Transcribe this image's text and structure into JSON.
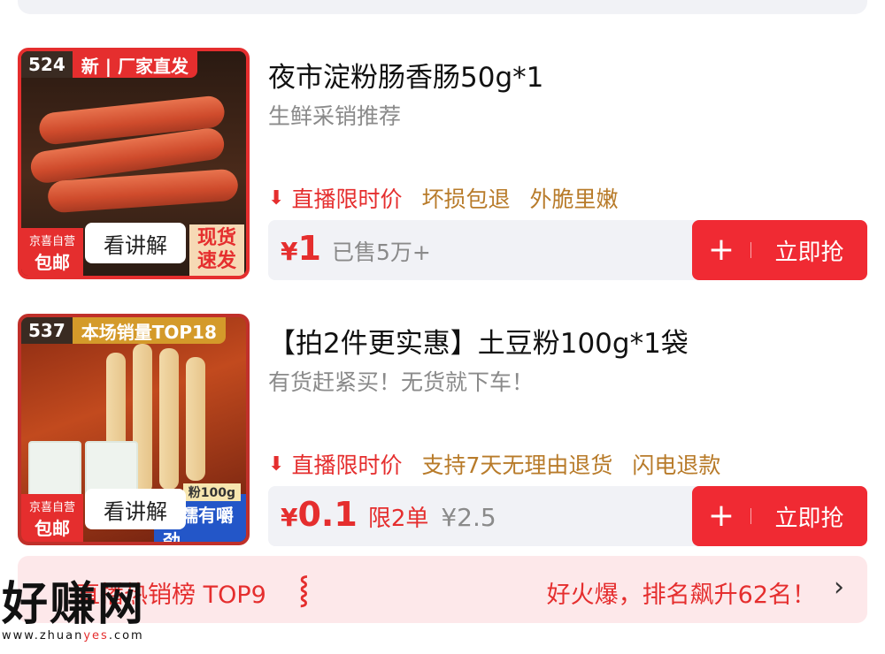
{
  "products": [
    {
      "rank": "524",
      "rank_tag": "新 | 厂家直发",
      "title": "夜市淀粉肠香肠50g*1",
      "subtitle": "生鲜采销推荐",
      "tags": [
        "直播限时价",
        "坏损包退",
        "外脆里嫩"
      ],
      "badge_top": "京喜自营",
      "badge_bottom": "包邮",
      "explain": "看讲解",
      "promo": "现货速发",
      "price_symbol": "¥",
      "price": "1",
      "sold": "已售5万+",
      "grab_label": "立即抢"
    },
    {
      "rank": "537",
      "rank_tag": "本场销量TOP18",
      "title": "【拍2件更实惠】土豆粉100g*1袋",
      "subtitle": "有货赶紧买！无货就下车！",
      "tags": [
        "直播限时价",
        "支持7天无理由退货",
        "闪电退款"
      ],
      "badge_top": "京喜自营",
      "badge_bottom": "包邮",
      "explain": "看讲解",
      "pack_size": "粉100g",
      "pack_slogan": "软糯有嚼劲",
      "price_symbol": "¥",
      "price": "0.1",
      "limit": "限2单",
      "original_price": "¥2.5",
      "grab_label": "立即抢"
    }
  ],
  "hot_rank": {
    "left": "直播热销榜 TOP9",
    "right": "好火爆，排名飙升62名！"
  },
  "watermark": {
    "main": "好赚网",
    "url_pre": "www.zhuan",
    "url_hl": "yes",
    "url_post": ".com"
  },
  "colors": {
    "accent": "#e52e2e",
    "button": "#f02a33",
    "tag_gold": "#b87b2a",
    "bar_bg": "#f1f2f6",
    "hot_bg": "#fde8ea"
  },
  "icons": {
    "down_arrow": "down-arrow-icon",
    "plus": "plus-icon",
    "chevron": "chevron-right-icon"
  }
}
